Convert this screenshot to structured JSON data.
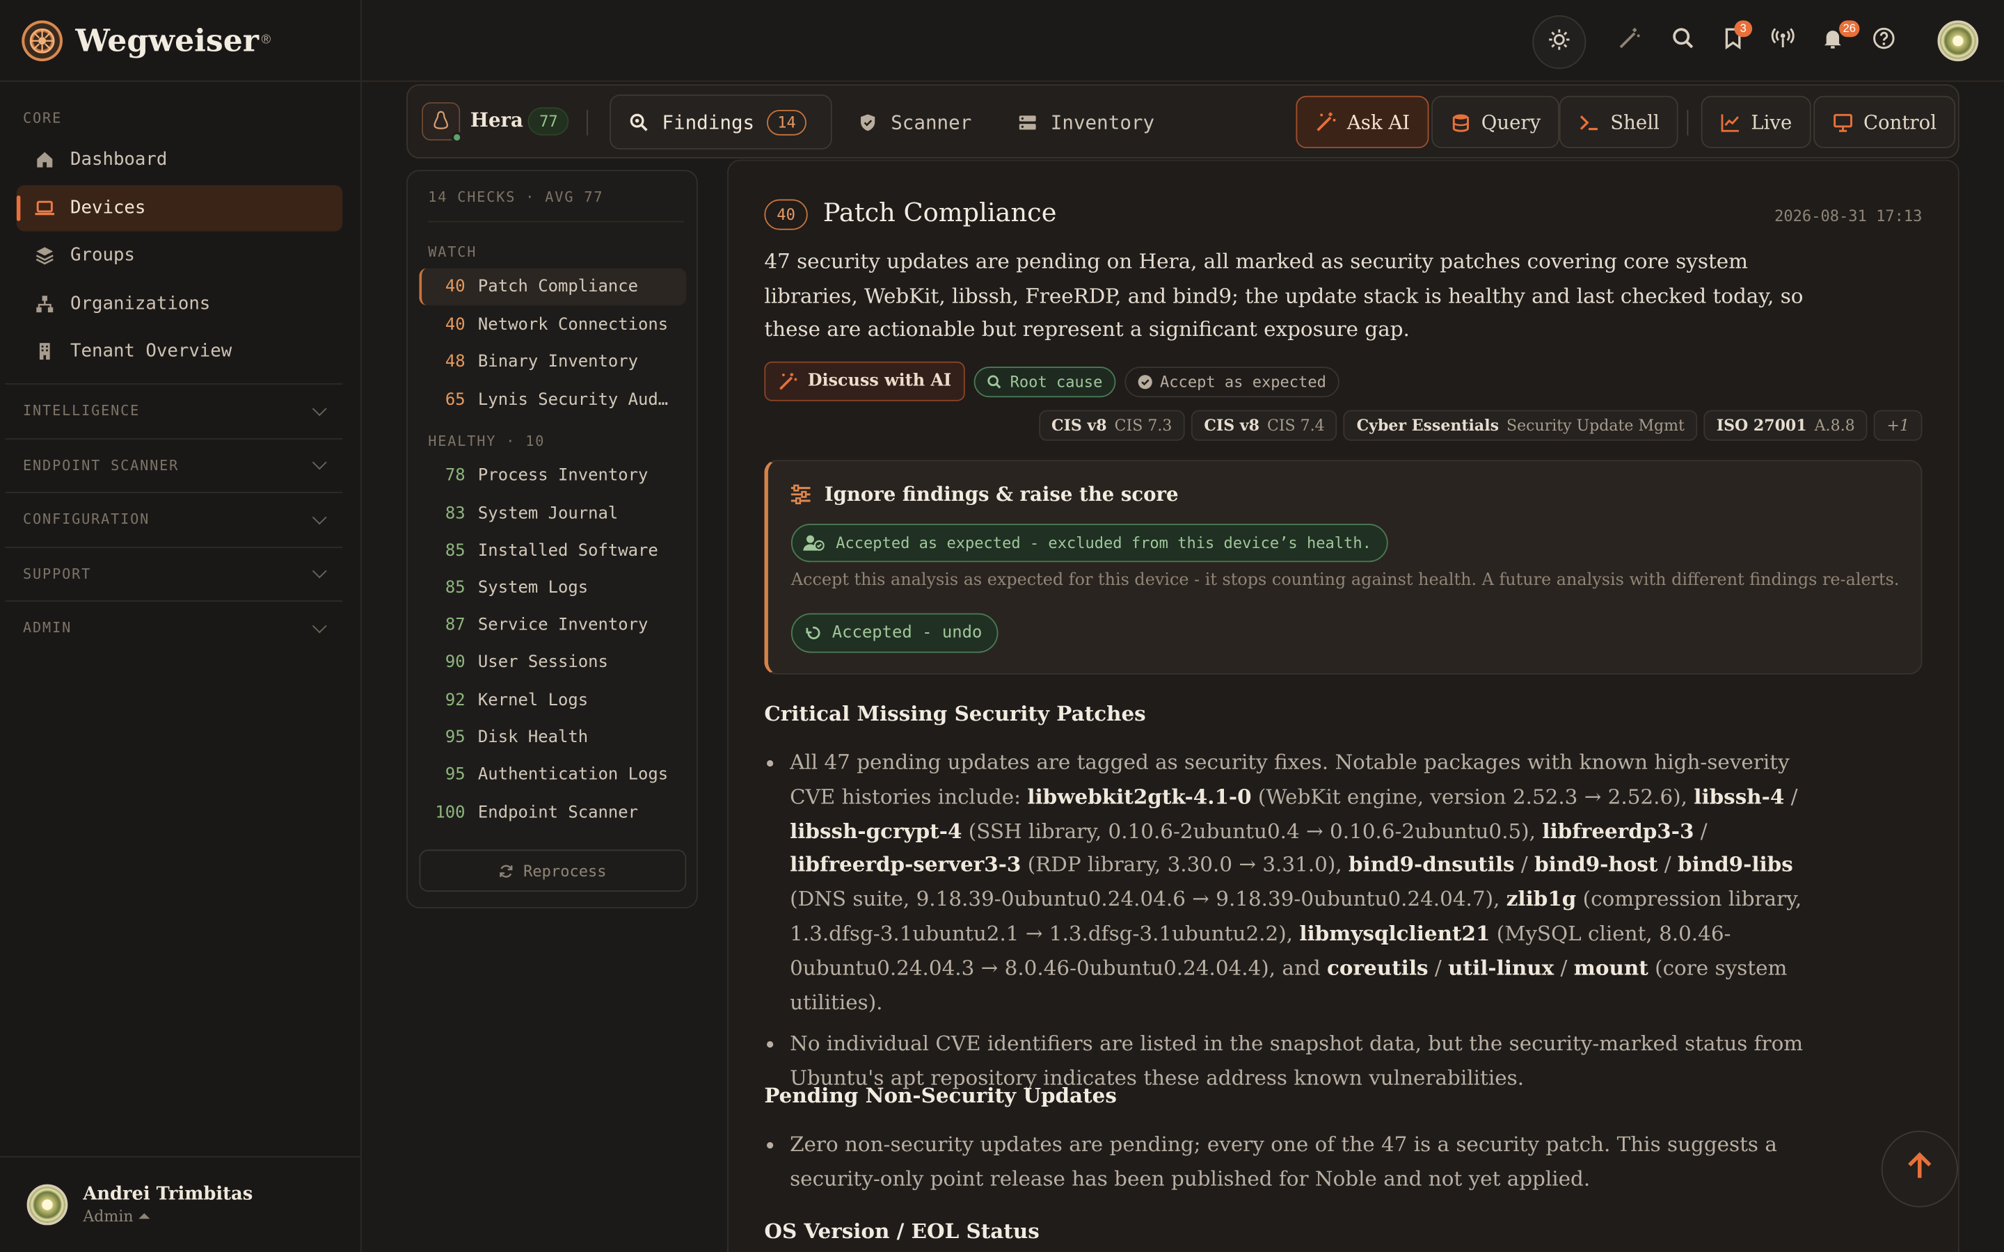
{
  "brand": {
    "name": "Wegweiser",
    "reg": "®"
  },
  "sidebar": {
    "core_label": "CORE",
    "items": [
      {
        "label": "Dashboard",
        "icon": "home-icon",
        "active": false
      },
      {
        "label": "Devices",
        "icon": "laptop-icon",
        "active": true
      },
      {
        "label": "Groups",
        "icon": "layers-icon",
        "active": false
      },
      {
        "label": "Organizations",
        "icon": "org-icon",
        "active": false
      },
      {
        "label": "Tenant Overview",
        "icon": "building-icon",
        "active": false
      }
    ],
    "sections": [
      "INTELLIGENCE",
      "ENDPOINT SCANNER",
      "CONFIGURATION",
      "SUPPORT",
      "ADMIN"
    ],
    "user": {
      "name": "Andrei Trimbitas",
      "role": "Admin ⏶"
    }
  },
  "topbar": {
    "icons": [
      "sun-icon",
      "magic-wand-icon",
      "search-icon",
      "bookmark-icon",
      "broadcast-icon",
      "bell-icon",
      "help-icon"
    ],
    "bookmark_badge": "3",
    "bell_badge": "26"
  },
  "device": {
    "name": "Hera",
    "score": "77",
    "tabs": [
      {
        "label": "Findings",
        "count": "14",
        "active": true
      },
      {
        "label": "Scanner"
      },
      {
        "label": "Inventory"
      }
    ],
    "actions": [
      {
        "label": "Ask AI",
        "primary": true
      },
      {
        "label": "Query"
      },
      {
        "label": "Shell"
      },
      {
        "label": "Live"
      },
      {
        "label": "Control"
      }
    ]
  },
  "checks": {
    "header": "14 CHECKS · AVG 77",
    "watch_label": "WATCH",
    "healthy_label": "HEALTHY · 10",
    "watch": [
      {
        "score": "40",
        "name": "Patch Compliance",
        "selected": true
      },
      {
        "score": "40",
        "name": "Network Connections"
      },
      {
        "score": "48",
        "name": "Binary Inventory"
      },
      {
        "score": "65",
        "name": "Lynis Security Aud…"
      }
    ],
    "healthy": [
      {
        "score": "78",
        "name": "Process Inventory"
      },
      {
        "score": "83",
        "name": "System Journal"
      },
      {
        "score": "85",
        "name": "Installed Software"
      },
      {
        "score": "85",
        "name": "System Logs"
      },
      {
        "score": "87",
        "name": "Service Inventory"
      },
      {
        "score": "90",
        "name": "User Sessions"
      },
      {
        "score": "92",
        "name": "Kernel Logs"
      },
      {
        "score": "95",
        "name": "Disk Health"
      },
      {
        "score": "95",
        "name": "Authentication Logs"
      },
      {
        "score": "100",
        "name": "Endpoint Scanner"
      }
    ],
    "reprocess_label": "Reprocess"
  },
  "detail": {
    "score": "40",
    "title": "Patch Compliance",
    "timestamp": "2026-08-31 17:13",
    "summary": "47 security updates are pending on Hera, all marked as security patches covering core system libraries, WebKit, libssh, FreeRDP, and bind9; the update stack is healthy and last checked today, so these are actionable but represent a significant exposure gap.",
    "discuss_label": "Discuss with AI",
    "root_cause_label": "Root cause",
    "accept_label": "Accept as expected",
    "tags": [
      {
        "std": "CIS v8",
        "ctrl": "CIS 7.3"
      },
      {
        "std": "CIS v8",
        "ctrl": "CIS 7.4"
      },
      {
        "std": "Cyber Essentials",
        "ctrl": "Security Update Mgmt"
      },
      {
        "std": "ISO 27001",
        "ctrl": "A.8.8"
      },
      {
        "std": "",
        "ctrl": "+1"
      }
    ],
    "ignore": {
      "title": "Ignore findings & raise the score",
      "status": "Accepted as expected - excluded from this device’s health.",
      "desc": "Accept this analysis as expected for this device - it stops counting against health. A future analysis with different findings re-alerts.",
      "undo": "Accepted - undo"
    },
    "section1": "Critical Missing Security Patches",
    "section2": "Pending Non-Security Updates",
    "section2_text": "Zero non-security updates are pending; every one of the 47 is a security patch. This suggests a security-only point release has been published for Noble and not yet applied.",
    "section3": "OS Version / EOL Status",
    "bullet2": "No individual CVE identifiers are listed in the snapshot data, but the security-marked status from Ubuntu's apt repository indicates these address known vulnerabilities.",
    "bullet1_parts": [
      {
        "t": "All 47 pending updates are tagged as security fixes. Notable packages with known high-severity CVE histories include: "
      },
      {
        "t": "libwebkit2gtk-4.1-0",
        "b": true
      },
      {
        "t": " (WebKit engine, version 2.52.3 → 2.52.6), "
      },
      {
        "t": "libssh-4",
        "b": true
      },
      {
        "t": " / "
      },
      {
        "t": "libssh-gcrypt-4",
        "b": true
      },
      {
        "t": " (SSH library, 0.10.6-2ubuntu0.4 → 0.10.6-2ubuntu0.5), "
      },
      {
        "t": "libfreerdp3-3",
        "b": true
      },
      {
        "t": " / "
      },
      {
        "t": "libfreerdp-server3-3",
        "b": true
      },
      {
        "t": " (RDP library, 3.30.0 → 3.31.0), "
      },
      {
        "t": "bind9-dnsutils",
        "b": true
      },
      {
        "t": " / "
      },
      {
        "t": "bind9-host",
        "b": true
      },
      {
        "t": " / "
      },
      {
        "t": "bind9-libs",
        "b": true
      },
      {
        "t": " (DNS suite, 9.18.39-0ubuntu0.24.04.6 → 9.18.39-0ubuntu0.24.04.7), "
      },
      {
        "t": "zlib1g",
        "b": true
      },
      {
        "t": " (compression library, 1.3.dfsg-3.1ubuntu2.1 → 1.3.dfsg-3.1ubuntu2.2), "
      },
      {
        "t": "libmysqlclient21",
        "b": true
      },
      {
        "t": " (MySQL client, 8.0.46-0ubuntu0.24.04.3 → 8.0.46-0ubuntu0.24.04.4), and "
      },
      {
        "t": "coreutils",
        "b": true
      },
      {
        "t": " / "
      },
      {
        "t": "util-linux",
        "b": true
      },
      {
        "t": " / "
      },
      {
        "t": "mount",
        "b": true
      },
      {
        "t": " (core system utilities)."
      }
    ]
  },
  "colors": {
    "accent": "#e8703a",
    "good": "#8db67e",
    "warn": "#e49a5e"
  }
}
